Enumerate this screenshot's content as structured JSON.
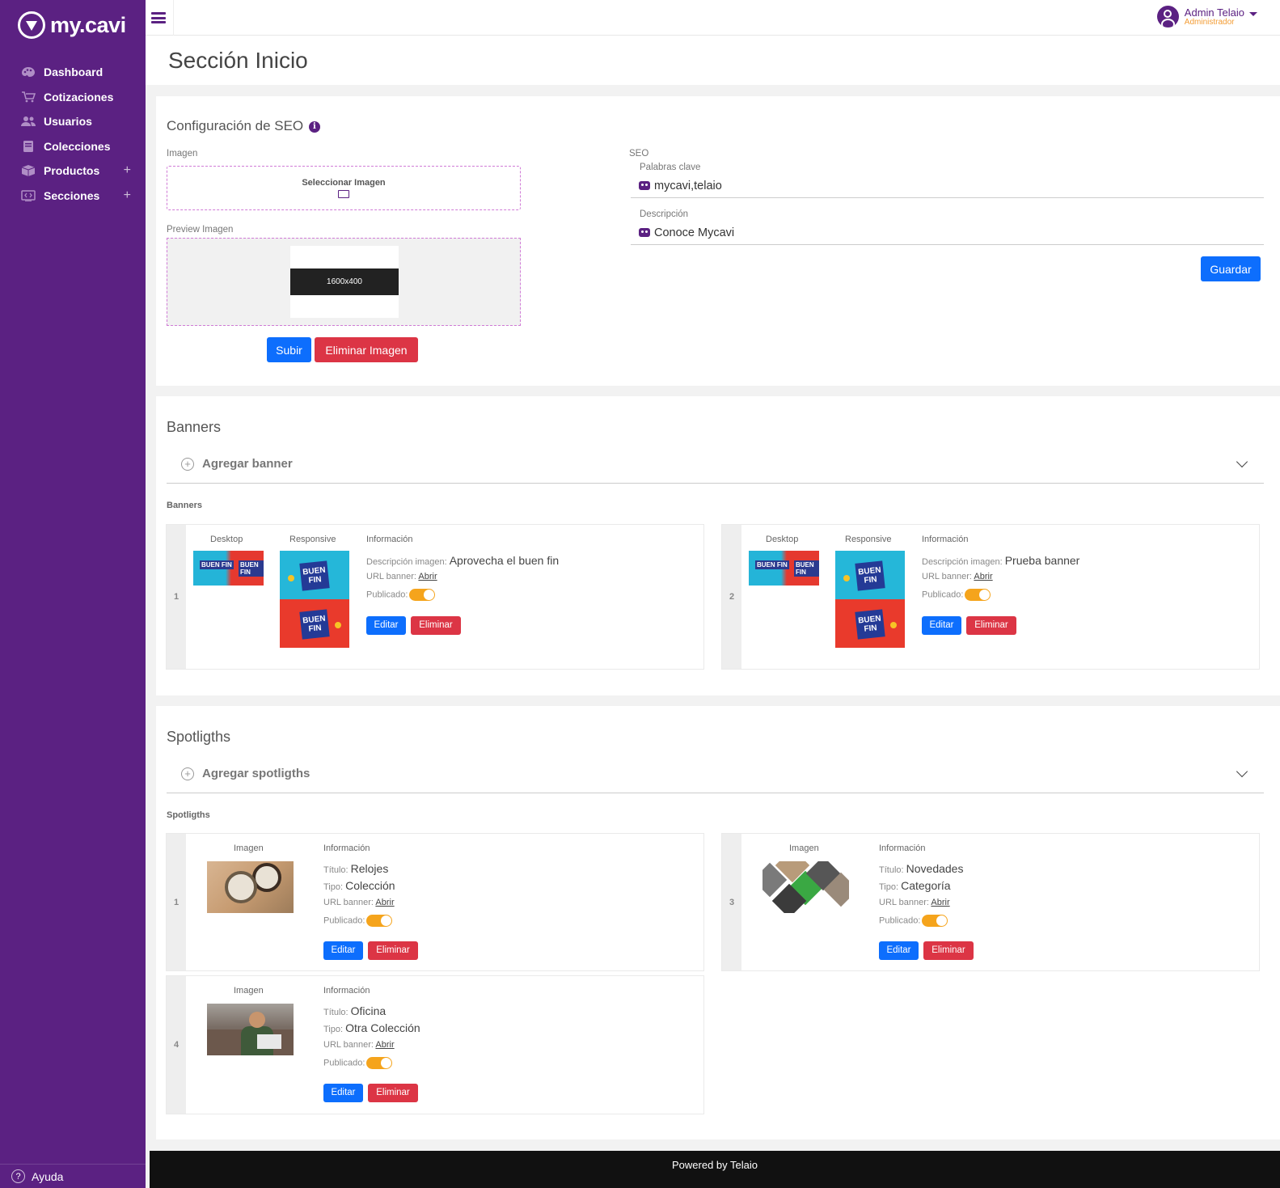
{
  "brand": {
    "logo_text": "my.cavi",
    "accent": "#5b2182",
    "secondary": "#f39c34"
  },
  "sidebar": {
    "items": [
      {
        "label": "Dashboard",
        "icon": "palette-icon"
      },
      {
        "label": "Cotizaciones",
        "icon": "cart-icon"
      },
      {
        "label": "Usuarios",
        "icon": "users-icon"
      },
      {
        "label": "Colecciones",
        "icon": "book-icon"
      },
      {
        "label": "Productos",
        "icon": "box-icon",
        "expand": "+"
      },
      {
        "label": "Secciones",
        "icon": "code-window-icon",
        "expand": "+"
      }
    ],
    "help_label": "Ayuda",
    "help_icon": "?"
  },
  "topbar": {
    "user_name": "Admin Telaio",
    "user_role": "Administrador"
  },
  "page": {
    "title": "Sección Inicio"
  },
  "seo": {
    "title": "Configuración de SEO",
    "info_icon": "i",
    "image_label": "Imagen",
    "select_image": "Seleccionar Imagen",
    "preview_label": "Preview Imagen",
    "preview_placeholder": "1600x400",
    "upload_btn": "Subir",
    "delete_image_btn": "Eliminar Imagen",
    "seo_label": "SEO",
    "keywords_label": "Palabras clave",
    "keywords_value": "mycavi,telaio",
    "description_label": "Descripción",
    "description_value": "Conoce Mycavi",
    "save_btn": "Guardar"
  },
  "banners": {
    "title": "Banners",
    "add_label": "Agregar banner",
    "list_heading": "Banners",
    "col_desktop": "Desktop",
    "col_responsive": "Responsive",
    "col_info": "Información",
    "desc_label": "Descripción imagen:",
    "url_label": "URL banner:",
    "url_link": "Abrir",
    "published_label": "Publicado:",
    "edit_btn": "Editar",
    "delete_btn": "Eliminar",
    "thumb_text": "BUEN FIN",
    "items": [
      {
        "num": "1",
        "description": "Aprovecha el buen fin",
        "published": true
      },
      {
        "num": "2",
        "description": "Prueba banner",
        "published": true
      }
    ]
  },
  "spotlights": {
    "title": "Spotligths",
    "add_label": "Agregar spotligths",
    "list_heading": "Spotligths",
    "col_image": "Imagen",
    "col_info": "Información",
    "title_label": "Título:",
    "type_label": "Tipo:",
    "url_label": "URL banner:",
    "url_link": "Abrir",
    "published_label": "Publicado:",
    "edit_btn": "Editar",
    "delete_btn": "Eliminar",
    "items": [
      {
        "num": "1",
        "title": "Relojes",
        "type": "Colección",
        "published": true
      },
      {
        "num": "3",
        "title": "Novedades",
        "type": "Categoría",
        "published": true
      },
      {
        "num": "4",
        "title": "Oficina",
        "type": "Otra Colección",
        "published": true
      }
    ]
  },
  "footer": {
    "text": "Powered by Telaio"
  }
}
